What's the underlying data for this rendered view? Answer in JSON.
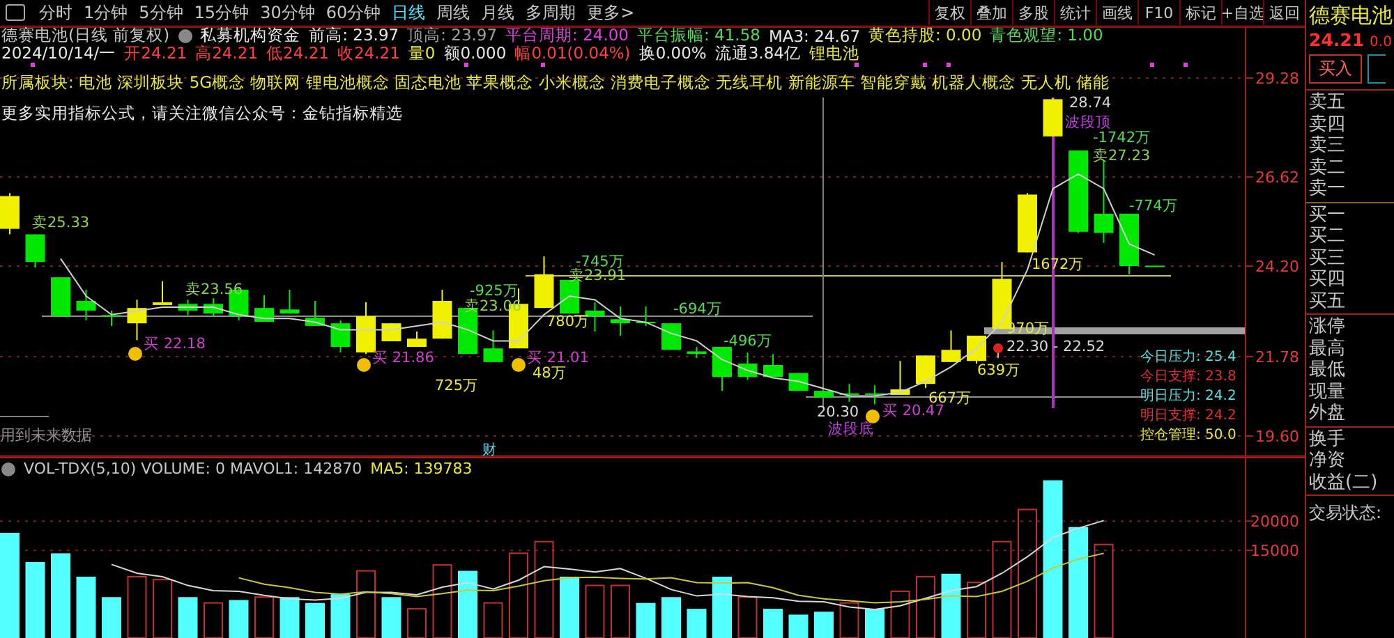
{
  "toolbar": {
    "periods": [
      {
        "label": "分时",
        "selected": false
      },
      {
        "label": "1分钟",
        "selected": false
      },
      {
        "label": "5分钟",
        "selected": false
      },
      {
        "label": "15分钟",
        "selected": false
      },
      {
        "label": "30分钟",
        "selected": false
      },
      {
        "label": "60分钟",
        "selected": false
      },
      {
        "label": "日线",
        "selected": true
      },
      {
        "label": "周线",
        "selected": false
      },
      {
        "label": "月线",
        "selected": false
      },
      {
        "label": "多周期",
        "selected": false
      }
    ],
    "more": "更多>",
    "buttons": [
      "复权",
      "叠加",
      "多股",
      "统计",
      "画线",
      "F10",
      "标记",
      "+自选",
      "返回"
    ]
  },
  "price_chart": {
    "title_line": [
      {
        "text": "德赛电池(日线 前复权)",
        "color": "#c8c8c8"
      },
      {
        "text": "私募机构资金",
        "color": "#e8e8e8"
      },
      {
        "text": "前高: 23.97",
        "color": "#e8e8e8"
      },
      {
        "text": "顶高: 23.97",
        "color": "#a0a0a0"
      },
      {
        "text": "平台周期: 24.00",
        "color": "#e040e0"
      },
      {
        "text": "平台振幅: 41.58",
        "color": "#58d858"
      },
      {
        "text": "MA3: 24.67",
        "color": "#e8e8e8"
      },
      {
        "text": "黄色持股: 0.00",
        "color": "#e8e83c"
      },
      {
        "text": "青色观望: 1.00",
        "color": "#58d858"
      }
    ],
    "quote_line": [
      {
        "text": "2024/10/14/一",
        "color": "#e8e8e8"
      },
      {
        "text": "开24.21",
        "color": "#ff4040"
      },
      {
        "text": "高24.21",
        "color": "#ff4040"
      },
      {
        "text": "低24.21",
        "color": "#ff4040"
      },
      {
        "text": "收24.21",
        "color": "#ff4040"
      },
      {
        "text": "量0",
        "color": "#e8e83c"
      },
      {
        "text": "额0.000",
        "color": "#e8e8e8"
      },
      {
        "text": "幅0.01(0.04%)",
        "color": "#ff4040"
      },
      {
        "text": "换0.00%",
        "color": "#e8e8e8"
      },
      {
        "text": "流通3.84亿",
        "color": "#e8e8e8"
      },
      {
        "text": "锂电池",
        "color": "#e8e83c"
      }
    ],
    "sectors": "所属板块: 电池 深圳板块 5G概念 物联网 锂电池概念 固态电池 苹果概念 小米概念 消费电子概念 无线耳机 新能源车 智能穿戴 机器人概念 无人机 储能",
    "notice": "更多实用指标公式，请关注微信公众号：金钻指标精选",
    "chart_data": {
      "type": "candlestick",
      "ylim": [
        19.05,
        30.65
      ],
      "grid": true,
      "yticks": [
        {
          "value": 19.6,
          "label": "19.60"
        },
        21.78,
        {
          "value": 24.2,
          "label": "24.20"
        },
        26.62,
        29.28
      ],
      "ohlc": [
        [
          25.21,
          26.18,
          25.06,
          26.1
        ],
        [
          25.06,
          25.06,
          24.16,
          24.31
        ],
        [
          23.9,
          23.9,
          22.86,
          22.86
        ],
        [
          23.27,
          23.57,
          22.75,
          23.01
        ],
        [
          22.89,
          23.01,
          22.6,
          22.86
        ],
        [
          22.67,
          23.3,
          22.22,
          23.08
        ],
        [
          23.16,
          23.79,
          23.16,
          23.23
        ],
        [
          23.19,
          23.3,
          22.89,
          23.01
        ],
        [
          23.19,
          23.34,
          22.86,
          22.93
        ],
        [
          23.57,
          23.64,
          22.75,
          22.86
        ],
        [
          23.08,
          23.42,
          22.71,
          22.71
        ],
        [
          23.04,
          23.57,
          22.93,
          22.93
        ],
        [
          22.82,
          23.27,
          22.6,
          22.6
        ],
        [
          22.67,
          22.75,
          21.89,
          22.04
        ],
        [
          21.89,
          23.23,
          21.85,
          22.86
        ],
        [
          22.19,
          22.67,
          22.19,
          22.67
        ],
        [
          22.04,
          22.45,
          22.04,
          22.26
        ],
        [
          22.26,
          23.57,
          22.26,
          23.27
        ],
        [
          23.08,
          23.08,
          21.85,
          21.85
        ],
        [
          22.0,
          22.48,
          21.63,
          21.63
        ],
        [
          22.0,
          23.6,
          22.0,
          23.19
        ],
        [
          23.08,
          24.46,
          23.08,
          23.98
        ],
        [
          23.83,
          23.83,
          22.93,
          22.93
        ],
        [
          23.01,
          23.23,
          22.45,
          22.86
        ],
        [
          22.78,
          23.12,
          22.34,
          22.67
        ],
        [
          22.71,
          23.12,
          22.6,
          22.67
        ],
        [
          22.67,
          22.67,
          21.96,
          21.96
        ],
        [
          21.92,
          22.04,
          21.74,
          21.85
        ],
        [
          22.04,
          22.04,
          20.84,
          21.22
        ],
        [
          21.59,
          21.89,
          21.14,
          21.22
        ],
        [
          21.55,
          21.85,
          21.22,
          21.22
        ],
        [
          21.33,
          21.33,
          20.84,
          20.84
        ],
        [
          20.84,
          20.84,
          20.66,
          20.66
        ],
        [
          20.77,
          21.03,
          20.54,
          20.73
        ],
        [
          20.77,
          20.99,
          20.47,
          20.73
        ],
        [
          20.73,
          21.66,
          20.73,
          20.88
        ],
        [
          21.03,
          21.81,
          20.92,
          21.81
        ],
        [
          21.63,
          22.48,
          21.63,
          21.96
        ],
        [
          21.66,
          22.34,
          21.59,
          22.34
        ],
        [
          22.52,
          24.31,
          22.52,
          23.86
        ],
        [
          24.57,
          26.18,
          24.57,
          26.14
        ],
        [
          27.71,
          28.74,
          27.71,
          28.71
        ],
        [
          27.33,
          27.33,
          25.1,
          25.13
        ],
        [
          25.62,
          27.07,
          24.83,
          25.1
        ],
        [
          25.62,
          25.62,
          23.98,
          24.2
        ],
        [
          24.21,
          24.21,
          24.21,
          24.21
        ]
      ],
      "series": [
        {
          "type": "line",
          "color": "#d0d0d0",
          "values": [
            null,
            null,
            24.4,
            23.4,
            22.9,
            23.0,
            23.1,
            23.1,
            23.1,
            22.9,
            22.8,
            22.8,
            22.7,
            22.5,
            22.5,
            22.5,
            22.6,
            22.7,
            22.5,
            22.2,
            22.2,
            22.9,
            23.4,
            23.3,
            22.8,
            22.7,
            22.4,
            22.2,
            21.7,
            21.4,
            21.2,
            21.1,
            20.9,
            20.7,
            20.7,
            20.8,
            21.1,
            21.5,
            22.0,
            22.7,
            24.1,
            26.3,
            26.7,
            26.3,
            24.8,
            24.5
          ]
        }
      ]
    },
    "annotations": [
      {
        "text": "28.74",
        "kind": "price"
      },
      {
        "text": "波段顶",
        "kind": "wave"
      },
      {
        "text": "-1742万",
        "kind": "flow_out"
      },
      {
        "text": "卖27.23",
        "kind": "sell"
      },
      {
        "text": "-774万",
        "kind": "flow_out"
      },
      {
        "text": "卖25.33",
        "kind": "sell"
      },
      {
        "text": "-745万",
        "kind": "flow_out"
      },
      {
        "text": "1672万",
        "kind": "flow_in"
      },
      {
        "text": "卖23.91",
        "kind": "sell"
      },
      {
        "text": "卖23.56",
        "kind": "sell"
      },
      {
        "text": "-925万",
        "kind": "flow_out"
      },
      {
        "text": "卖23.06",
        "kind": "sell"
      },
      {
        "text": "-694万",
        "kind": "flow_out"
      },
      {
        "text": "780万",
        "kind": "flow_in"
      },
      {
        "text": "970万",
        "kind": "flow_in"
      },
      {
        "text": "买 22.18",
        "kind": "buy"
      },
      {
        "text": "-496万",
        "kind": "flow_out"
      },
      {
        "text": "22.30 - 22.52",
        "kind": "price"
      },
      {
        "text": "买 21.86",
        "kind": "buy"
      },
      {
        "text": "买 21.01",
        "kind": "buy"
      },
      {
        "text": "48万",
        "kind": "flow_in"
      },
      {
        "text": "639万",
        "kind": "flow_in"
      },
      {
        "text": "725万",
        "kind": "flow_in"
      },
      {
        "text": "667万",
        "kind": "flow_in"
      },
      {
        "text": "20.30",
        "kind": "price"
      },
      {
        "text": "买 20.47",
        "kind": "buy"
      },
      {
        "text": "波段底",
        "kind": "wave"
      }
    ],
    "levels": [
      {
        "text": "今日压力: 25.4",
        "kind": "pressure"
      },
      {
        "text": "今日支撑: 23.8",
        "kind": "support"
      },
      {
        "text": "明日压力: 24.2",
        "kind": "pressure"
      },
      {
        "text": "明日支撑: 24.2",
        "kind": "support"
      },
      {
        "text": "控仓管理: 50.0",
        "kind": "position"
      }
    ],
    "future_data_note": "用到未来数据",
    "finance_marker": "财"
  },
  "volume_chart": {
    "header": [
      {
        "text": "VOL-TDX(5,10) VOLUME: 0 MAVOL1: 142870",
        "color": "#c8c8c8"
      },
      {
        "text": "MA5: 139783",
        "color": "#e8e83c"
      }
    ],
    "bars": [
      {
        "rising": false
      },
      {
        "rising": false
      },
      {
        "rising": false
      },
      {
        "rising": false
      },
      {
        "rising": false
      },
      {
        "rising": true
      },
      {
        "rising": true
      },
      {
        "rising": false
      },
      {
        "rising": true
      },
      {
        "rising": false
      },
      {
        "rising": true
      },
      {
        "rising": false
      },
      {
        "rising": false
      },
      {
        "rising": false
      },
      {
        "rising": true
      },
      {
        "rising": false
      },
      {
        "rising": true
      },
      {
        "rising": true
      },
      {
        "rising": false
      },
      {
        "rising": true
      },
      {
        "rising": true
      },
      {
        "rising": true
      },
      {
        "rising": false
      },
      {
        "rising": true
      },
      {
        "rising": true
      },
      {
        "rising": false
      },
      {
        "rising": false
      },
      {
        "rising": false
      },
      {
        "rising": false
      },
      {
        "rising": true
      },
      {
        "rising": false
      },
      {
        "rising": false
      },
      {
        "rising": false
      },
      {
        "rising": true
      },
      {
        "rising": false
      },
      {
        "rising": true
      },
      {
        "rising": true
      },
      {
        "rising": false
      },
      {
        "rising": true
      },
      {
        "rising": true
      },
      {
        "rising": true
      },
      {
        "rising": false
      },
      {
        "rising": false
      },
      {
        "rising": true
      }
    ],
    "chart_data": {
      "type": "bar",
      "ylim": [
        0,
        31000
      ],
      "yticks": [
        15000,
        20000
      ],
      "series": [
        {
          "colors": [
            "#54ffff",
            "#54ffff",
            "#54ffff",
            "#54ffff",
            "#54ffff",
            "#c03030",
            "#c03030",
            "#54ffff",
            "#c03030",
            "#54ffff",
            "#c03030",
            "#54ffff",
            "#54ffff",
            "#54ffff",
            "#c03030",
            "#54ffff",
            "#c03030",
            "#c03030",
            "#54ffff",
            "#c03030",
            "#c03030",
            "#c03030",
            "#54ffff",
            "#c03030",
            "#c03030",
            "#54ffff",
            "#54ffff",
            "#54ffff",
            "#54ffff",
            "#c03030",
            "#54ffff",
            "#54ffff",
            "#54ffff",
            "#c03030",
            "#54ffff",
            "#c03030",
            "#c03030",
            "#54ffff",
            "#c03030",
            "#c03030",
            "#c03030",
            "#54ffff",
            "#54ffff",
            "#c03030",
            null,
            null,
            null,
            null,
            null
          ],
          "values": [
            18000,
            13000,
            14500,
            10500,
            7000,
            10500,
            10000,
            7000,
            6000,
            6500,
            7000,
            7000,
            6000,
            7500,
            11500,
            7000,
            5000,
            12500,
            11500,
            6000,
            14500,
            16500,
            10500,
            9000,
            9000,
            6000,
            7000,
            5000,
            10500,
            7000,
            5000,
            4000,
            4500,
            6000,
            5000,
            8000,
            10500,
            11000,
            9500,
            16500,
            22000,
            27000,
            19000,
            16000,
            null,
            null,
            null,
            null,
            null
          ]
        },
        {
          "type": "line",
          "color": "#d8d8d8",
          "values": [
            null,
            null,
            null,
            null,
            12600,
            11100,
            10500,
            9000,
            8100,
            8000,
            7300,
            6700,
            6500,
            6800,
            7800,
            7800,
            7400,
            8700,
            9500,
            8400,
            9900,
            12200,
            11800,
            11300,
            11900,
            10200,
            8300,
            7200,
            7500,
            7100,
            6900,
            6300,
            6200,
            5300,
            4900,
            5500,
            6800,
            8100,
            8800,
            11100,
            13900,
            17200,
            18800,
            20100,
            null,
            null,
            null,
            null,
            null
          ]
        },
        {
          "type": "line",
          "color": "#c8c840",
          "values": [
            null,
            null,
            null,
            null,
            null,
            null,
            null,
            null,
            null,
            10300,
            9200,
            8600,
            7800,
            7500,
            7900,
            7600,
            7100,
            7600,
            8200,
            8100,
            8900,
            9800,
            10300,
            10400,
            10200,
            10100,
            10300,
            9500,
            9400,
            9500,
            8600,
            7300,
            6700,
            6400,
            6000,
            6200,
            6600,
            7200,
            7100,
            8000,
            9700,
            12000,
            13500,
            14500,
            null,
            null,
            null,
            null,
            null
          ]
        }
      ]
    }
  },
  "quote": {
    "name": "德赛电池",
    "price": "24.21",
    "change": "0.0",
    "buy_button": "买入"
  },
  "order_book": {
    "asks": [
      "卖五",
      "卖四",
      "卖三",
      "卖二",
      "卖一"
    ],
    "bids": [
      "买一",
      "买二",
      "买三",
      "买四",
      "买五"
    ],
    "stats": [
      "涨停",
      "最高",
      "最低",
      "现量",
      "外盘"
    ],
    "finance": [
      "换手",
      "净资",
      "收益(二)"
    ],
    "trade_status": "交易状态:"
  }
}
